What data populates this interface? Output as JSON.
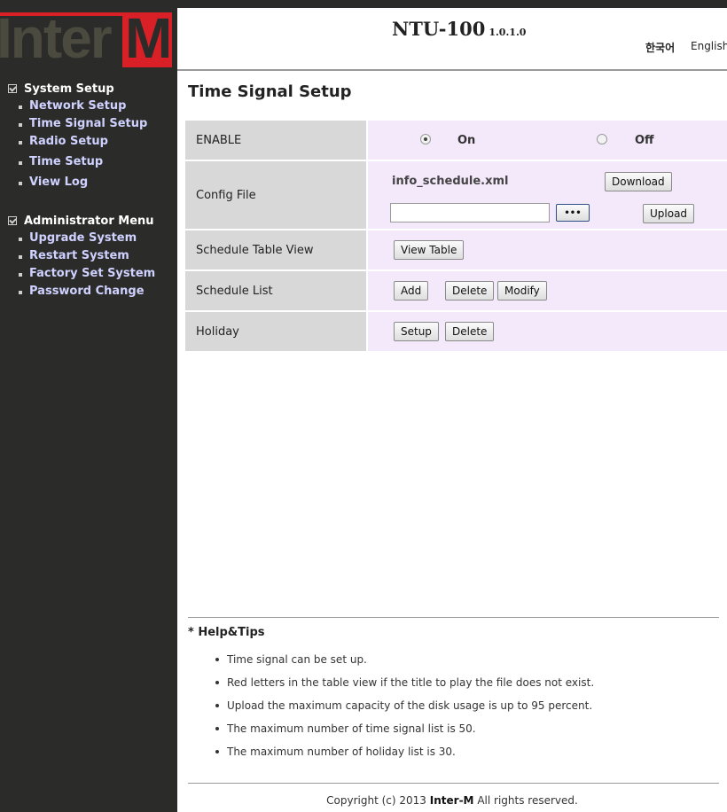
{
  "header": {
    "app_name": "NTU-100",
    "version": "1.0.1.0",
    "lang_korean": "한국어",
    "lang_english": "English"
  },
  "logo": {
    "text_inter": "Inter",
    "text_m": "M"
  },
  "sidebar": {
    "groups": [
      {
        "title": "System Setup",
        "items": [
          "Network Setup",
          "Time Signal Setup",
          "Radio Setup",
          "Time Setup",
          "View Log"
        ]
      },
      {
        "title": "Administrator Menu",
        "items": [
          "Upgrade System",
          "Restart System",
          "Factory Set System",
          "Password Change"
        ]
      }
    ]
  },
  "page": {
    "title": "Time Signal Setup",
    "rows": {
      "enable": {
        "label": "ENABLE",
        "on_label": "On",
        "off_label": "Off",
        "selected": "On"
      },
      "config_file": {
        "label": "Config File",
        "file_name": "info_schedule.xml",
        "download": "Download",
        "browse": "•••",
        "upload": "Upload",
        "file_value": ""
      },
      "schedule_table_view": {
        "label": "Schedule Table View",
        "view_table": "View Table"
      },
      "schedule_list": {
        "label": "Schedule List",
        "add": "Add",
        "delete": "Delete",
        "modify": "Modify"
      },
      "holiday": {
        "label": "Holiday",
        "setup": "Setup",
        "delete": "Delete"
      }
    }
  },
  "help": {
    "title": "* Help&Tips",
    "tips": [
      "Time signal can be set up.",
      "Red letters in the table view if the title to play the file does not exist.",
      "Upload the maximum capacity of the disk usage is up to 95 percent.",
      "The maximum number of time signal list is 50.",
      "The maximum number of holiday list is 30."
    ]
  },
  "footer": {
    "prefix": "Copyright (c) 2013",
    "brand": "Inter-M",
    "suffix": "All rights reserved."
  },
  "colors": {
    "sidebar_bg": "#2b2c2a",
    "brand_red": "#d92027",
    "menu_link": "#cfd1ff",
    "label_bg": "#d8d8d8",
    "value_bg": "#f4e8fb"
  }
}
